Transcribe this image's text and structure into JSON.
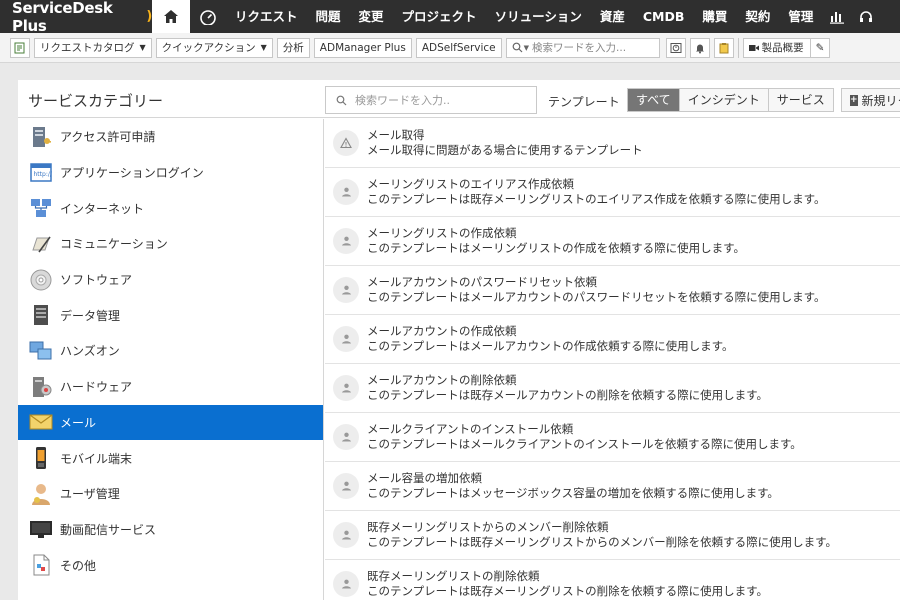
{
  "app": {
    "logo_text": "ServiceDesk Plus"
  },
  "nav": {
    "items": [
      "リクエスト",
      "問題",
      "変更",
      "プロジェクト",
      "ソリューション",
      "資産",
      "CMDB",
      "購買",
      "契約",
      "管理"
    ]
  },
  "toolbar": {
    "request_catalog": "リクエストカタログ",
    "quick_action": "クイックアクション",
    "analysis": "分析",
    "admanager": "ADManager Plus",
    "adselfservice": "ADSelfService",
    "search_placeholder": "検索ワードを入力...",
    "product_overview": "製品概要"
  },
  "panel": {
    "title": "サービスカテゴリー",
    "search_placeholder": "検索ワードを入力..",
    "template_label": "テンプレート",
    "filters": [
      "すべて",
      "インシデント",
      "サービス"
    ],
    "active_filter": "すべて",
    "new_button": "新規リクエスト"
  },
  "categories": [
    {
      "label": "アクセス許可申請",
      "icon": "server-key-icon"
    },
    {
      "label": "アプリケーションログイン",
      "icon": "browser-window-icon"
    },
    {
      "label": "インターネット",
      "icon": "network-icon"
    },
    {
      "label": "コミュニケーション",
      "icon": "pen-paper-icon"
    },
    {
      "label": "ソフトウェア",
      "icon": "cd-disc-icon"
    },
    {
      "label": "データ管理",
      "icon": "database-server-icon"
    },
    {
      "label": "ハンズオン",
      "icon": "computers-icon"
    },
    {
      "label": "ハードウェア",
      "icon": "hardware-tower-icon"
    },
    {
      "label": "メール",
      "icon": "envelope-icon"
    },
    {
      "label": "モバイル端末",
      "icon": "mobile-phone-icon"
    },
    {
      "label": "ユーザ管理",
      "icon": "user-icon"
    },
    {
      "label": "動画配信サービス",
      "icon": "monitor-icon"
    },
    {
      "label": "その他",
      "icon": "document-icon"
    }
  ],
  "active_category": "メール",
  "templates": [
    {
      "name": "メール取得",
      "desc": "メール取得に問題がある場合に使用するテンプレート",
      "icon": "warning-icon"
    },
    {
      "name": "メーリングリストのエイリアス作成依頼",
      "desc": "このテンプレートは既存メーリングリストのエイリアス作成を依頼する際に使用します。",
      "icon": "service-request-icon"
    },
    {
      "name": "メーリングリストの作成依頼",
      "desc": "このテンプレートはメーリングリストの作成を依頼する際に使用します。",
      "icon": "service-request-icon"
    },
    {
      "name": "メールアカウントのパスワードリセット依頼",
      "desc": "このテンプレートはメールアカウントのパスワードリセットを依頼する際に使用します。",
      "icon": "service-request-icon"
    },
    {
      "name": "メールアカウントの作成依頼",
      "desc": "このテンプレートはメールアカウントの作成依頼する際に使用します。",
      "icon": "service-request-icon"
    },
    {
      "name": "メールアカウントの削除依頼",
      "desc": "このテンプレートは既存メールアカウントの削除を依頼する際に使用します。",
      "icon": "service-request-icon"
    },
    {
      "name": "メールクライアントのインストール依頼",
      "desc": "このテンプレートはメールクライアントのインストールを依頼する際に使用します。",
      "icon": "service-request-icon"
    },
    {
      "name": "メール容量の増加依頼",
      "desc": "このテンプレートはメッセージボックス容量の増加を依頼する際に使用します。",
      "icon": "service-request-icon"
    },
    {
      "name": "既存メーリングリストからのメンバー削除依頼",
      "desc": "このテンプレートは既存メーリングリストからのメンバー削除を依頼する際に使用します。",
      "icon": "service-request-icon"
    },
    {
      "name": "既存メーリングリストの削除依頼",
      "desc": "このテンプレートは既存メーリングリストの削除を依頼する際に使用します。",
      "icon": "service-request-icon"
    }
  ],
  "colors": {
    "nav_bg": "#2f2f2f",
    "accent": "#0a6fd0",
    "logo_swoosh": "#f6b21b"
  }
}
